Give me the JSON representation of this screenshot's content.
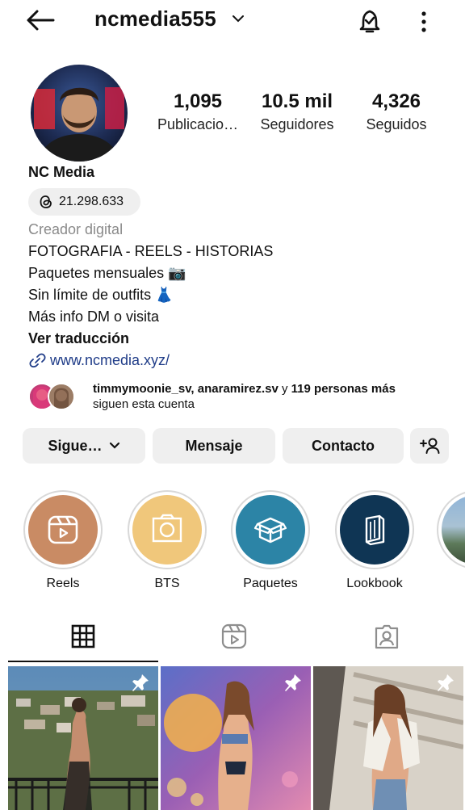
{
  "header": {
    "username": "ncmedia555"
  },
  "stats": [
    {
      "value": "1,095",
      "label": "Publicacio…"
    },
    {
      "value": "10.5 mil",
      "label": "Seguidores"
    },
    {
      "value": "4,326",
      "label": "Seguidos"
    }
  ],
  "profile": {
    "name": "NC Media",
    "threads_count": "21.298.633",
    "category": "Creador digital",
    "bio": [
      "FOTOGRAFIA - REELS - HISTORIAS",
      "Paquetes mensuales 📷",
      "Sin límite de outfits 👗",
      "Más info DM o visita"
    ],
    "translate": "Ver traducción",
    "link": "www.ncmedia.xyz/"
  },
  "followers": {
    "names": "timmymoonie_sv, anaramirez.sv",
    "connector": " y ",
    "more": "119 personas más",
    "suffix": "siguen esta cuenta"
  },
  "actions": {
    "following": "Sigue…",
    "message": "Mensaje",
    "contact": "Contacto"
  },
  "highlights": [
    {
      "label": "Reels",
      "color": "#c98b64",
      "icon": "reels-icon"
    },
    {
      "label": "BTS",
      "color": "#f0c77b",
      "icon": "camera-icon"
    },
    {
      "label": "Paquetes",
      "color": "#2c84a6",
      "icon": "box-icon"
    },
    {
      "label": "Lookbook",
      "color": "#0f3554",
      "icon": "book-icon"
    }
  ],
  "colors": {
    "link": "#1f3c88",
    "secondary_text": "#8a8a8a",
    "button_bg": "#efefef"
  }
}
